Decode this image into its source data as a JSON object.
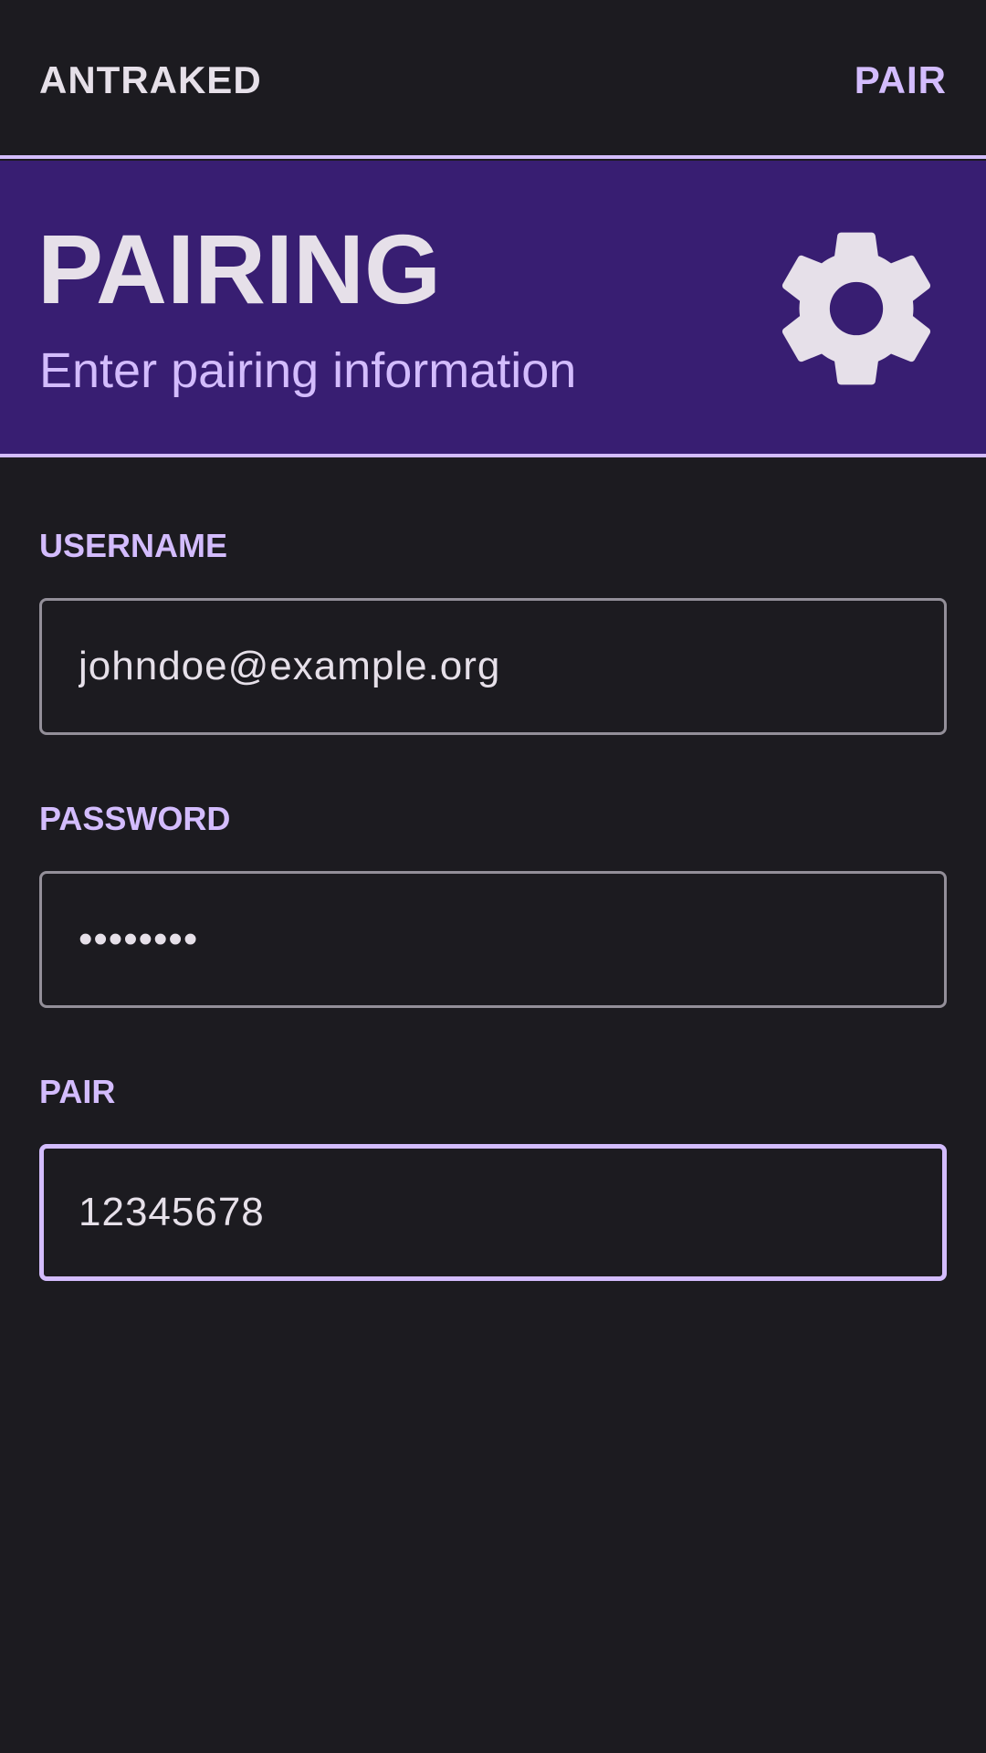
{
  "topbar": {
    "app_title": "ANTRAKED",
    "action_label": "PAIR"
  },
  "banner": {
    "title": "PAIRING",
    "subtitle": "Enter pairing information",
    "icon": "gear-icon"
  },
  "form": {
    "username": {
      "label": "USERNAME",
      "value": "johndoe@example.org"
    },
    "password": {
      "label": "PASSWORD",
      "value": "••••••••"
    },
    "pair": {
      "label": "PAIR",
      "value": "12345678"
    }
  },
  "colors": {
    "background": "#1c1b20",
    "accent": "#d3bcfd",
    "banner": "#381e72",
    "text": "#e6e0e9",
    "outline": "#938f99"
  }
}
